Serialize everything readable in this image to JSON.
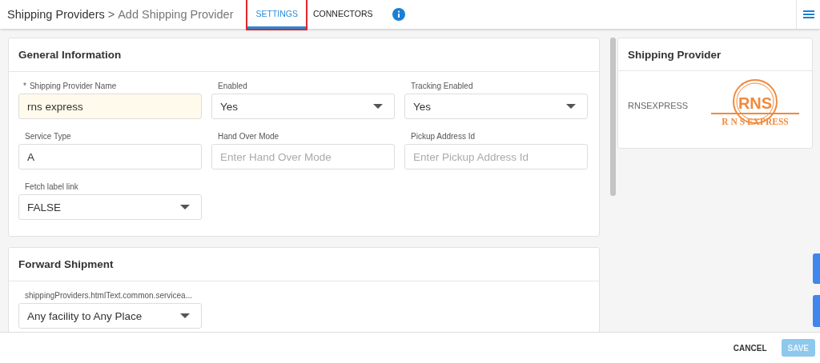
{
  "breadcrumb": {
    "parent": "Shipping Providers",
    "separator": ">",
    "current": "Add Shipping Provider"
  },
  "tabs": [
    {
      "label": "SETTINGS",
      "selected": true,
      "annotated": true
    },
    {
      "label": "CONNECTORS",
      "selected": false,
      "annotated": false
    }
  ],
  "required_marker": "*",
  "general": {
    "title": "General Information",
    "fields": [
      {
        "label": "Shipping Provider Name",
        "required": true,
        "kind": "text",
        "value": "rns express"
      },
      {
        "label": "Enabled",
        "required": false,
        "kind": "select",
        "value": "Yes"
      },
      {
        "label": "Tracking Enabled",
        "required": false,
        "kind": "select",
        "value": "Yes"
      },
      {
        "label": "Service Type",
        "required": false,
        "kind": "text",
        "value": "A"
      },
      {
        "label": "Hand Over Mode",
        "required": false,
        "kind": "text",
        "placeholder": "Enter Hand Over Mode"
      },
      {
        "label": "Pickup Address Id",
        "required": false,
        "kind": "text",
        "placeholder": "Enter Pickup Address Id"
      },
      {
        "label": "Fetch label link",
        "required": false,
        "kind": "select",
        "value": "FALSE"
      }
    ]
  },
  "forward": {
    "title": "Forward Shipment",
    "fields": [
      {
        "label": "shippingProviders.htmlText.common.servicea...",
        "required": false,
        "kind": "select",
        "value": "Any facility to Any Place"
      }
    ]
  },
  "provider_card": {
    "title": "Shipping Provider",
    "code": "RNSEXPRESS",
    "logo_letters": "RNS",
    "logo_text": "R N S EXPRESS"
  },
  "footer": {
    "buttons": [
      {
        "label": "CANCEL",
        "kind": "flat",
        "disabled": false
      },
      {
        "label": "SAVE",
        "kind": "raised",
        "disabled": true
      }
    ]
  }
}
